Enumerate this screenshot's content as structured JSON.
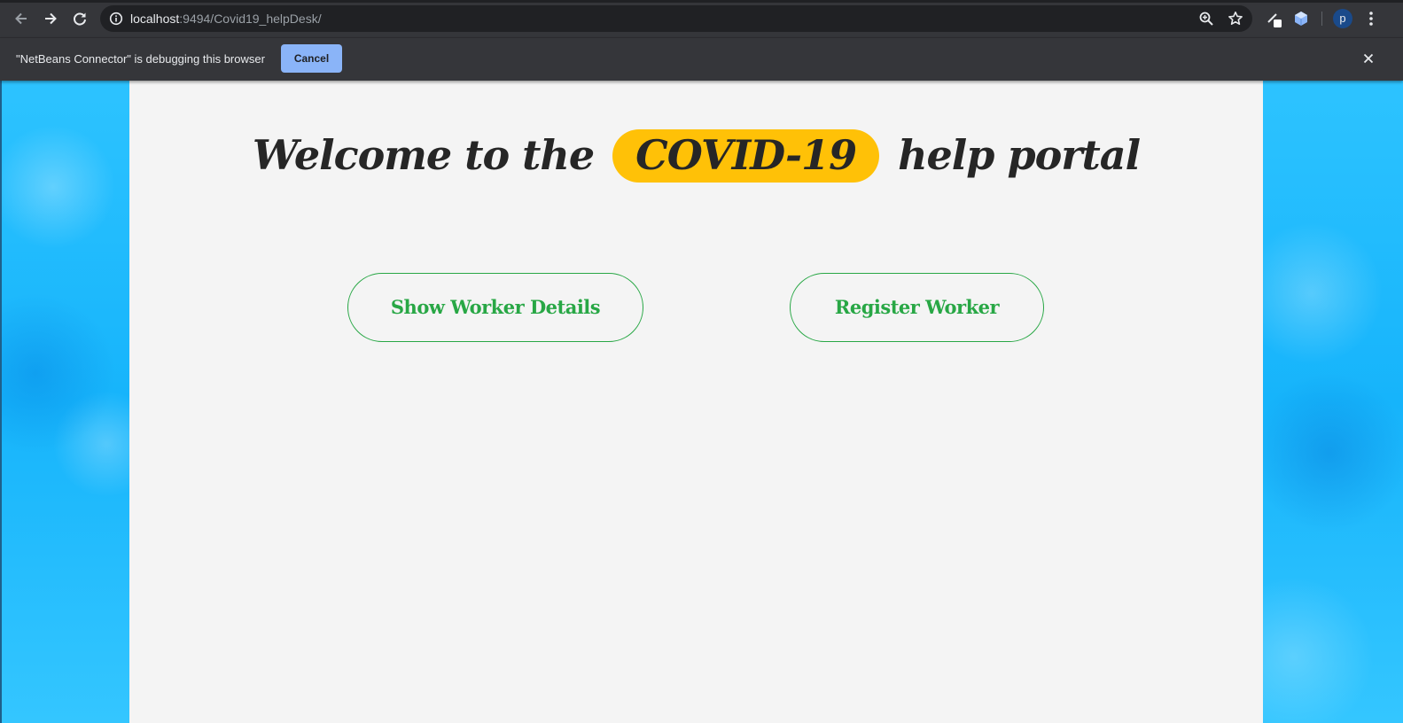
{
  "browser": {
    "url_host": "localhost",
    "url_rest": ":9494/Covid19_helpDesk/",
    "avatar_letter": "p"
  },
  "infobar": {
    "message": "\"NetBeans Connector\" is debugging this browser",
    "cancel_label": "Cancel"
  },
  "page": {
    "headline_before": "Welcome to the",
    "headline_highlight": "COVID-19",
    "headline_after": "help portal",
    "buttons": [
      {
        "label": "Show Worker Details"
      },
      {
        "label": "Register Worker"
      }
    ]
  },
  "colors": {
    "highlight": "#ffc107",
    "button_accent": "#28a745",
    "panel_background": "#f4f4f4",
    "page_background": "#1ab6fb"
  }
}
